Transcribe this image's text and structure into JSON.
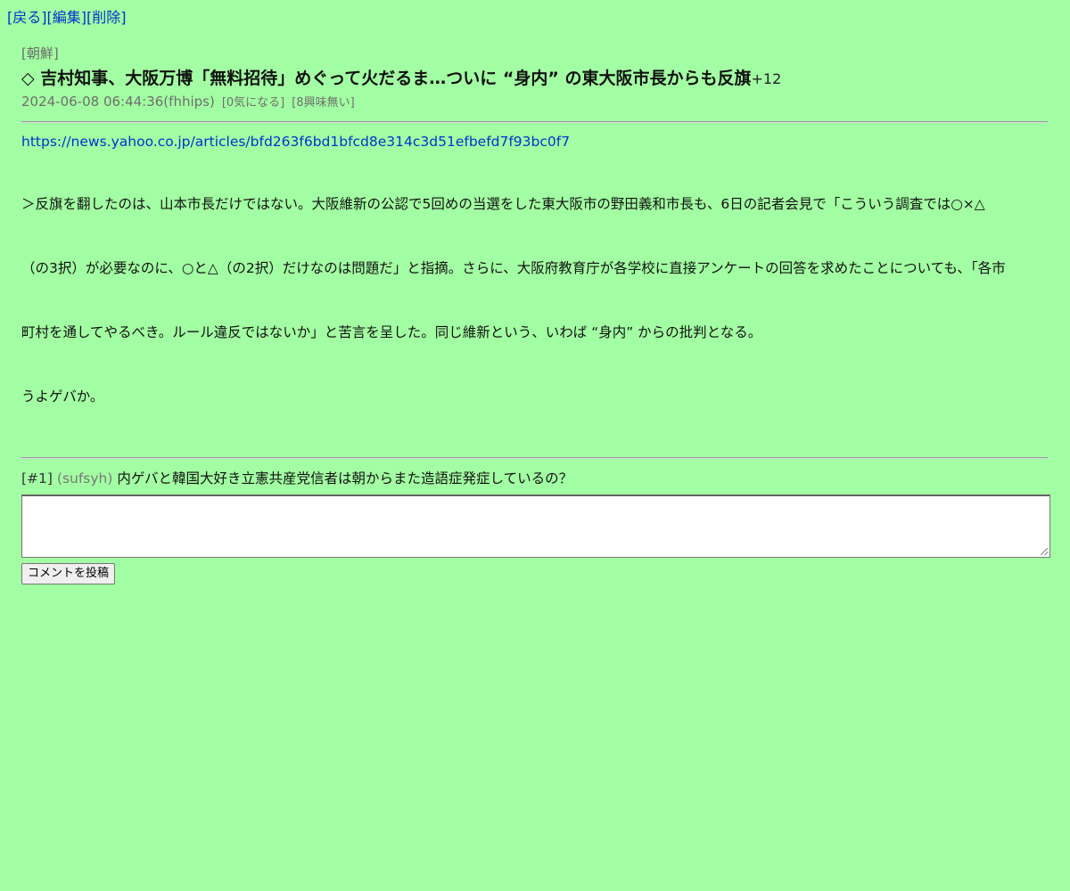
{
  "nav": {
    "back": "[戻る]",
    "edit": "[編集]",
    "delete": "[削除]"
  },
  "article": {
    "category": "[朝鮮]",
    "title": "◇ 吉村知事、大阪万博「無料招待」めぐって火だるま…ついに “身内” の東大阪市長からも反旗",
    "count": "+12",
    "datetime_user": "2024-06-08 06:44:36(fhhips)",
    "tag_interested": "[0気になる]",
    "tag_not_interested": "[8興味無い]",
    "url": "https://news.yahoo.co.jp/articles/bfd263f6bd1bfcd8e314c3d51efbefd7f93bc0f7",
    "body_line1": "＞反旗を翻したのは、山本市長だけではない。大阪維新の公認で5回めの当選をした東大阪市の野田義和市長も、6日の記者会見で「こういう調査では○×△",
    "body_line2": "（の3択）が必要なのに、○と△（の2択）だけなのは問題だ」と指摘。さらに、大阪府教育庁が各学校に直接アンケートの回答を求めたことについても、「各市",
    "body_line3": "町村を通してやるべき。ルール違反ではないか」と苦言を呈した。同じ維新という、いわば “身内” からの批判となる。",
    "body_line4": "うよゲバか。"
  },
  "comments": [
    {
      "number": "[#1]",
      "user": "(sufsyh)",
      "text": "内ゲバと韓国大好き立憲共産党信者は朝からまた造語症発症しているの？"
    }
  ],
  "reply": {
    "value": "",
    "submit_label": "コメントを投稿"
  },
  "colors": {
    "background": "#a3ffa3",
    "link": "#0033cc",
    "muted": "#6e6e6e"
  }
}
